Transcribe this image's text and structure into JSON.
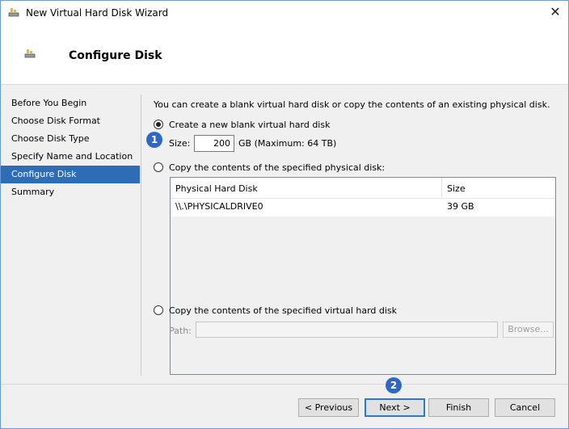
{
  "window": {
    "title": "New Virtual Hard Disk Wizard",
    "close_glyph": "✕"
  },
  "header": {
    "title": "Configure Disk",
    "icon": "hard-disk-icon"
  },
  "nav": {
    "items": [
      {
        "label": "Before You Begin"
      },
      {
        "label": "Choose Disk Format"
      },
      {
        "label": "Choose Disk Type"
      },
      {
        "label": "Specify Name and Location"
      },
      {
        "label": "Configure Disk",
        "active": true
      },
      {
        "label": "Summary"
      }
    ]
  },
  "main": {
    "intro": "You can create a blank virtual hard disk or copy the contents of an existing physical disk.",
    "option_new": {
      "label": "Create a new blank virtual hard disk",
      "selected": true,
      "size_label": "Size:",
      "size_value": "200",
      "size_unit": "GB (Maximum: 64 TB)"
    },
    "option_physical": {
      "label": "Copy the contents of the specified physical disk:",
      "selected": false,
      "columns": [
        "Physical Hard Disk",
        "Size"
      ],
      "rows": [
        {
          "disk": "\\\\.\\PHYSICALDRIVE0",
          "size": "39 GB"
        }
      ]
    },
    "option_virtual": {
      "label": "Copy the contents of the specified virtual hard disk",
      "selected": false,
      "path_label": "Path:",
      "path_value": "",
      "browse_label": "Browse..."
    }
  },
  "buttons": {
    "previous": "< Previous",
    "next": "Next >",
    "finish": "Finish",
    "cancel": "Cancel"
  },
  "badges": {
    "one": "1",
    "two": "2"
  },
  "colors": {
    "accent": "#2e6db5",
    "badge": "#2f67c5"
  }
}
